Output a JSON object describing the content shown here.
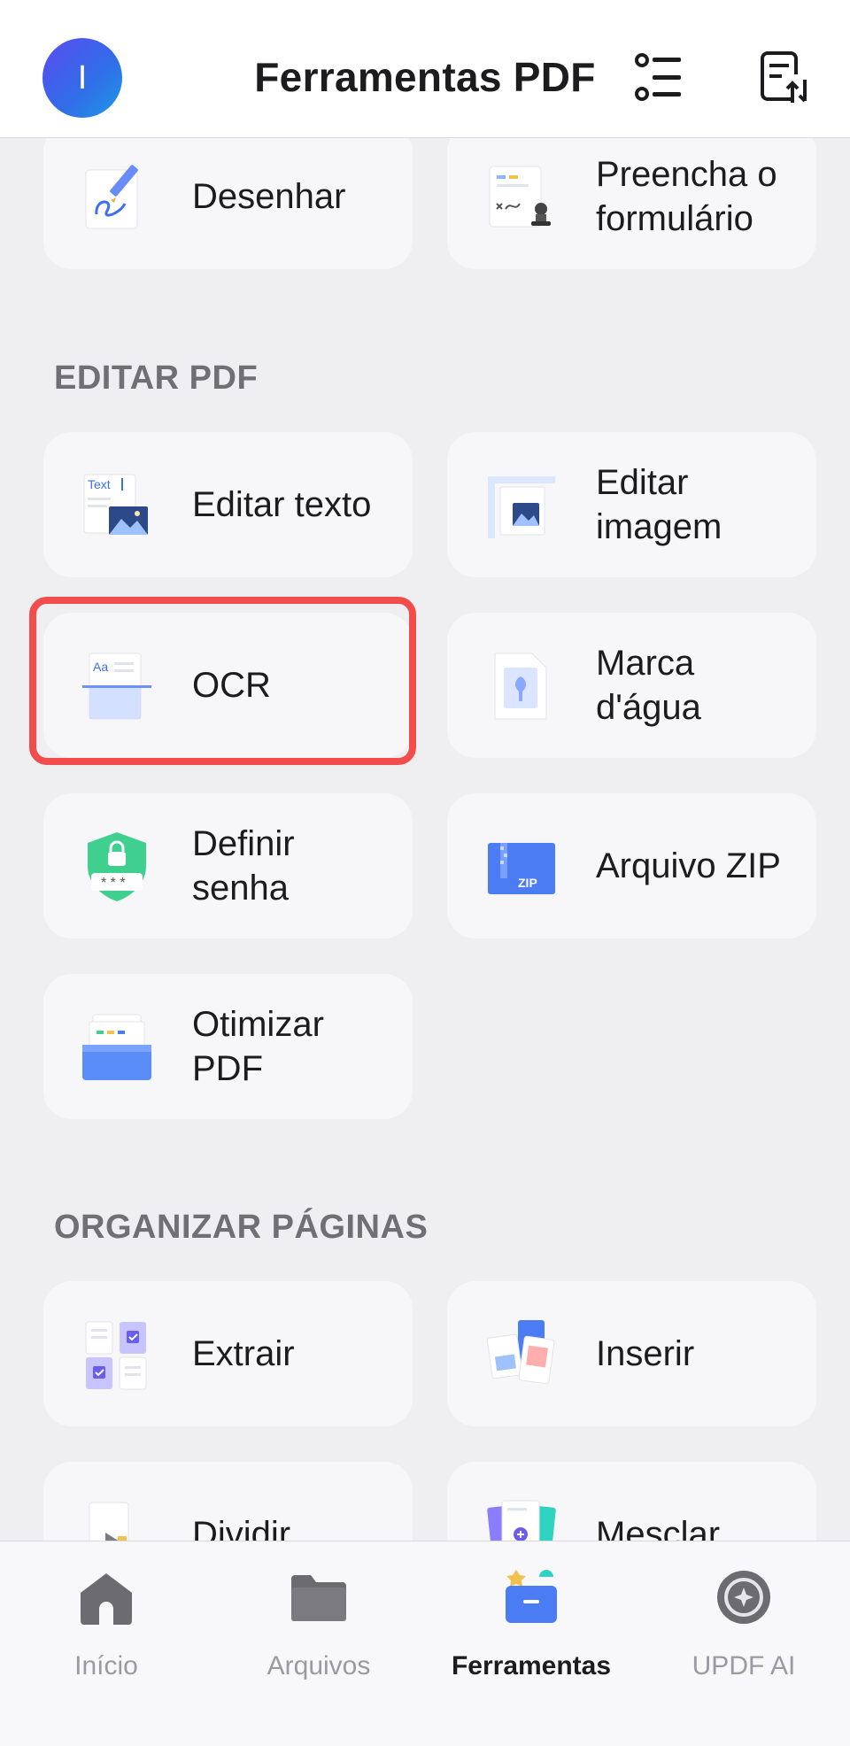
{
  "header": {
    "avatar_initial": "I",
    "title": "Ferramentas PDF",
    "icons": [
      "list-icon",
      "sort-icon"
    ]
  },
  "sections": {
    "top_cards": [
      {
        "label": "Desenhar",
        "icon": "draw-icon"
      },
      {
        "label": "Preencha o formulário",
        "icon": "fill-form-icon"
      }
    ],
    "editar_pdf": {
      "title": "EDITAR PDF",
      "cards": [
        {
          "label": "Editar texto",
          "icon": "edit-text-icon"
        },
        {
          "label": "Editar imagem",
          "icon": "edit-image-icon"
        },
        {
          "label": "OCR",
          "icon": "ocr-icon"
        },
        {
          "label": "Marca d'água",
          "icon": "watermark-icon"
        },
        {
          "label": "Definir senha",
          "icon": "password-shield-icon"
        },
        {
          "label": "Arquivo ZIP",
          "icon": "zip-icon"
        },
        {
          "label": "Otimizar PDF",
          "icon": "optimize-icon"
        }
      ]
    },
    "organizar_paginas": {
      "title": "ORGANIZAR PÁGINAS",
      "cards": [
        {
          "label": "Extrair",
          "icon": "extract-icon"
        },
        {
          "label": "Inserir",
          "icon": "insert-icon"
        },
        {
          "label": "Dividir",
          "icon": "split-icon"
        },
        {
          "label": "Mesclar",
          "icon": "merge-icon"
        }
      ]
    }
  },
  "tabs": [
    {
      "label": "Início",
      "icon": "home-icon",
      "active": false
    },
    {
      "label": "Arquivos",
      "icon": "folder-icon",
      "active": false
    },
    {
      "label": "Ferramentas",
      "icon": "tools-icon",
      "active": true
    },
    {
      "label": "UPDF AI",
      "icon": "ai-icon",
      "active": false
    }
  ],
  "colors": {
    "accent": "#4f7cf7",
    "highlight": "#f34c4c",
    "background": "#efeff1",
    "card": "#f7f7f9"
  }
}
